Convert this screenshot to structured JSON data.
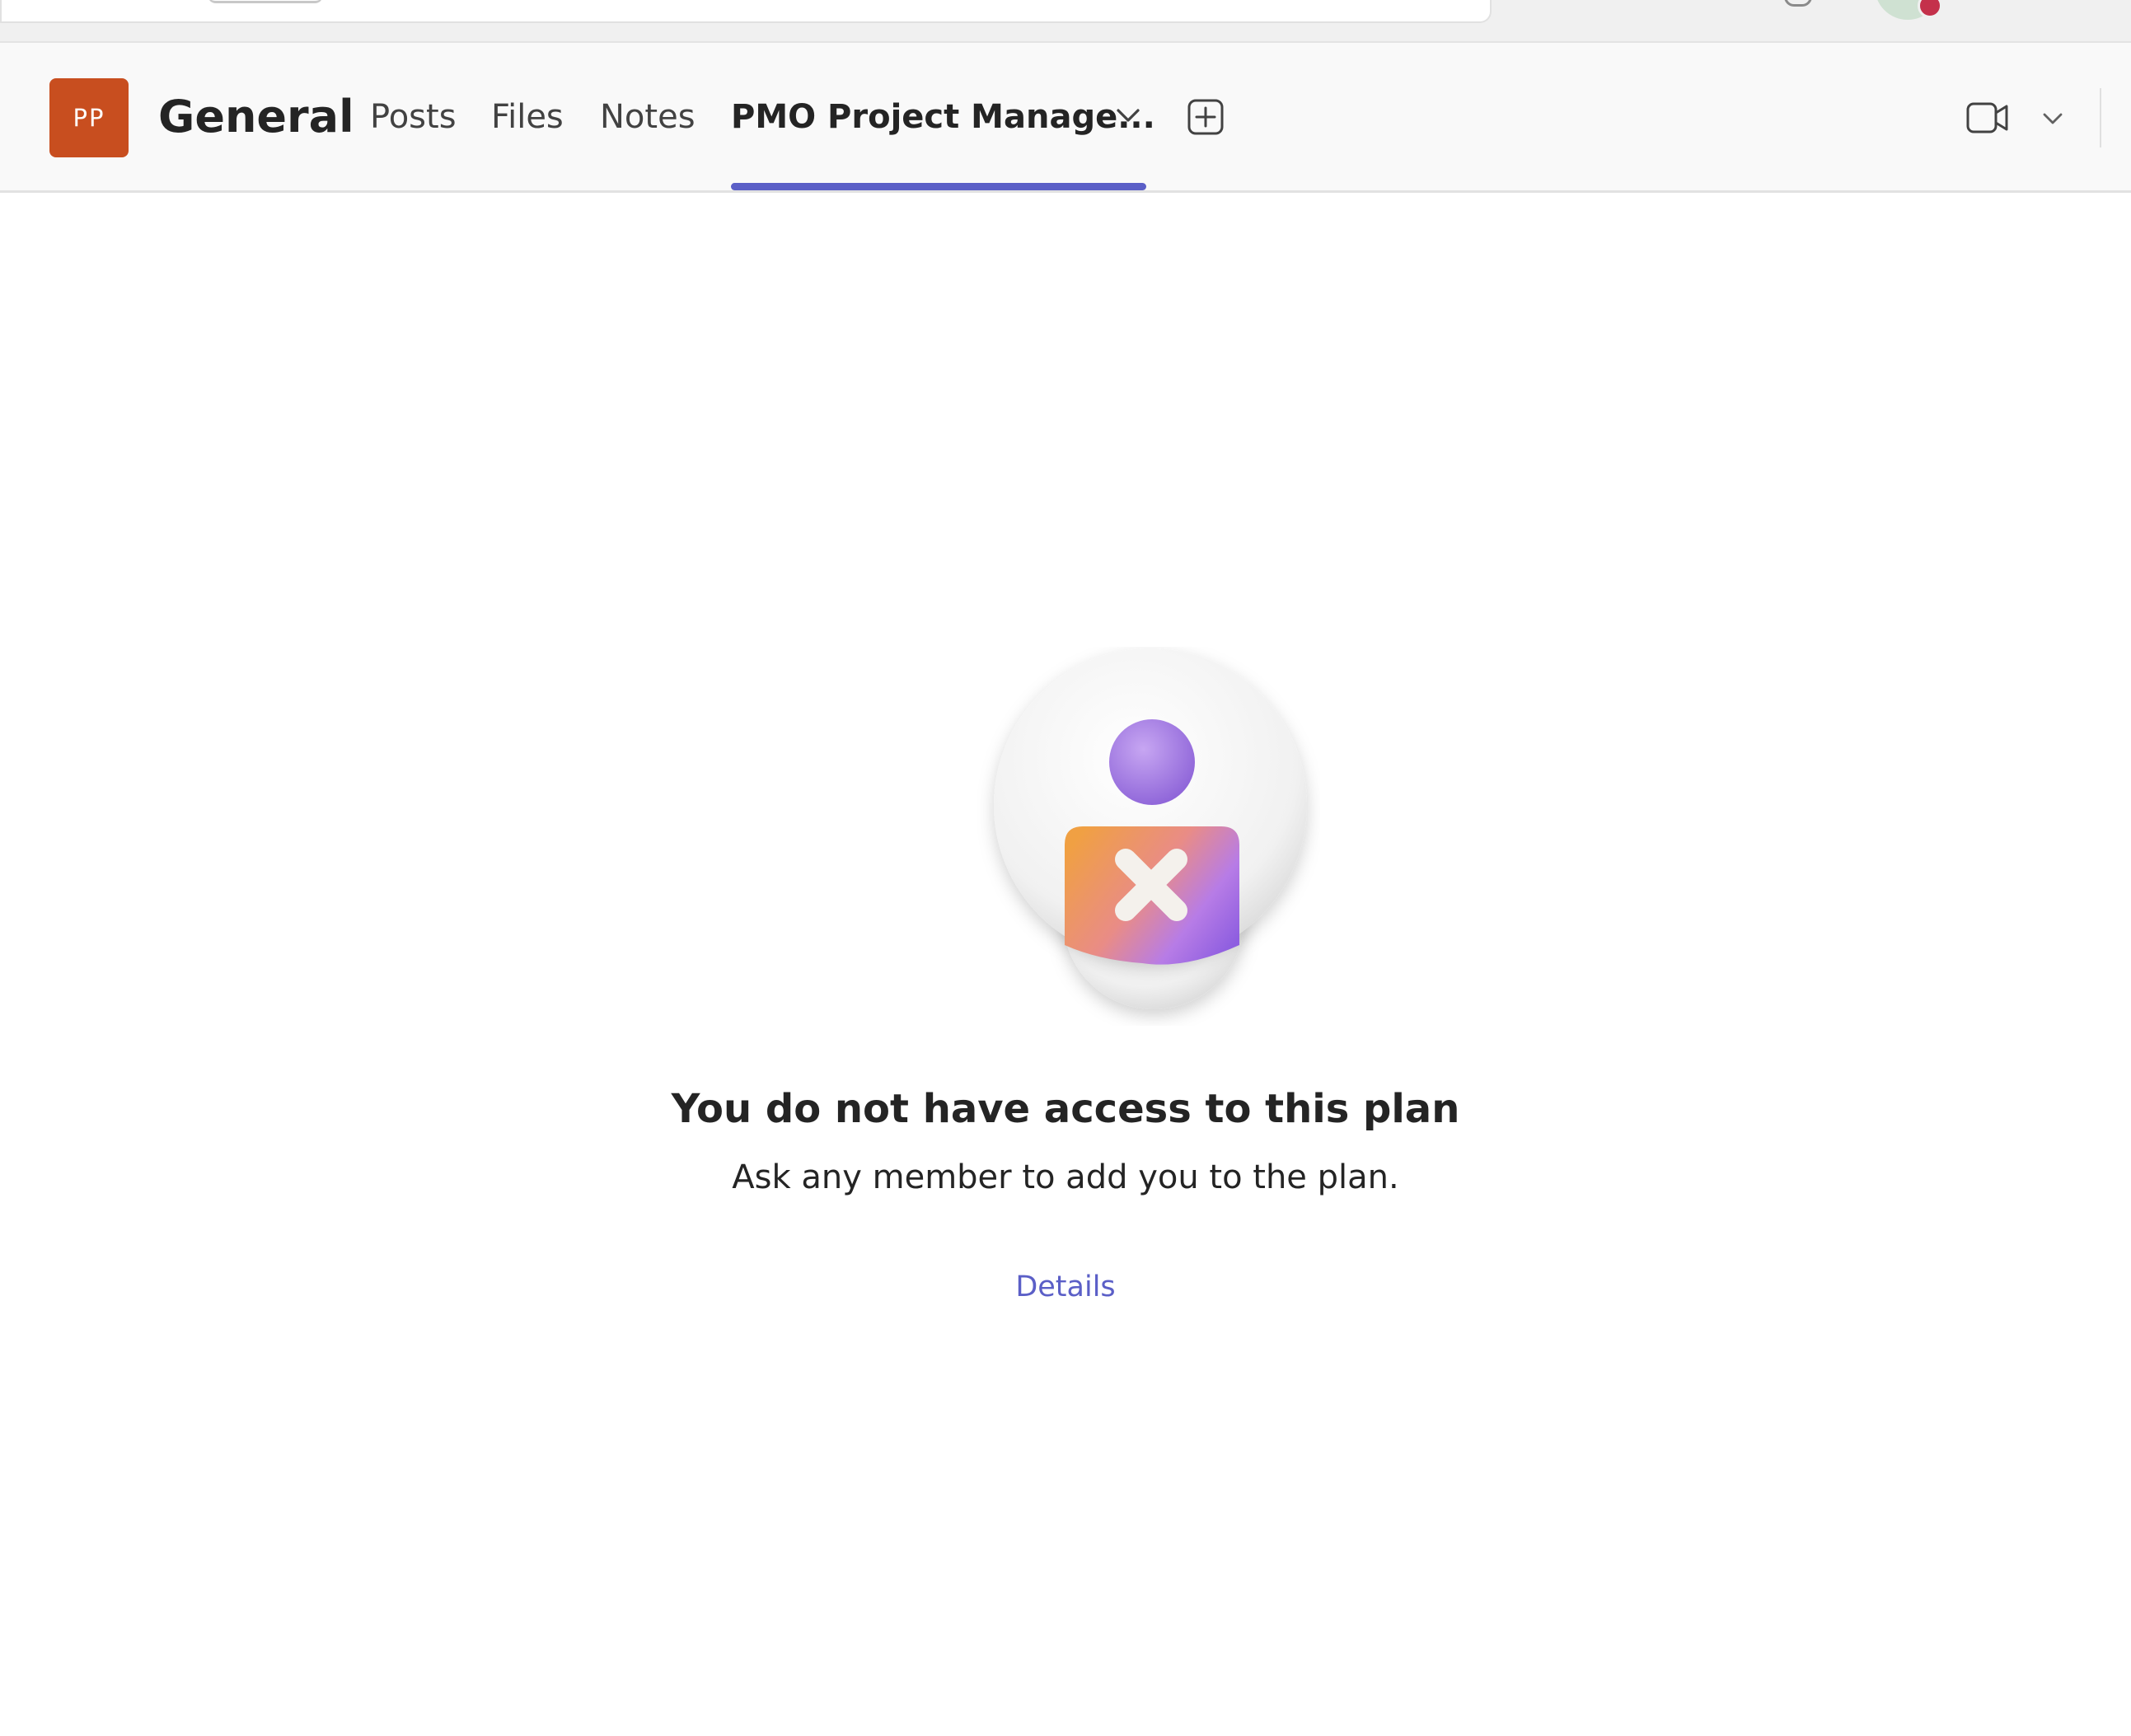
{
  "team": {
    "avatar_initials": "PP",
    "avatar_color": "#c84e1f"
  },
  "channel": {
    "title": "General"
  },
  "tabs": [
    {
      "label": "Posts"
    },
    {
      "label": "Files"
    },
    {
      "label": "Notes"
    },
    {
      "label": "PMO Project Manage...",
      "active": true
    }
  ],
  "icons": {
    "tab_dropdown": "chevron-down-icon",
    "add_tab": "add-square-icon",
    "meet": "video-camera-icon",
    "meet_dropdown": "chevron-down-icon"
  },
  "colors": {
    "accent": "#5b5fc7",
    "presence_busy": "#c4314b"
  },
  "message": {
    "title": "You do not have access to this plan",
    "subtitle": "Ask any member to add you to the plan.",
    "details_link": "Details"
  }
}
